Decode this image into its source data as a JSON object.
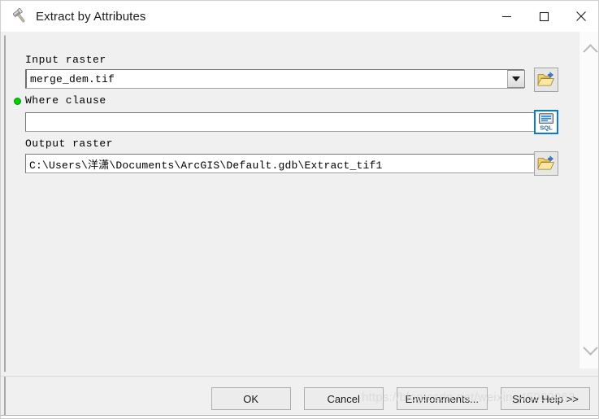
{
  "window": {
    "title": "Extract by Attributes",
    "icon": "hammer-tool-icon",
    "minimize_label": "—",
    "maximize_label": "□",
    "close_label": "✕"
  },
  "fields": {
    "input_raster": {
      "label": "Input raster",
      "value": "merge_dem.tif",
      "placeholder": "",
      "dropdown_icon": "chevron-down-icon",
      "browse_icon": "open-folder-icon",
      "required": false
    },
    "where_clause": {
      "label": "Where clause",
      "value": "",
      "placeholder": "",
      "sql_button_label": "SQL",
      "required": true,
      "required_marker_color": "#00cc00"
    },
    "output_raster": {
      "label": "Output raster",
      "value": "C:\\Users\\洋潇\\Documents\\ArcGIS\\Default.gdb\\Extract_tif1",
      "placeholder": "",
      "browse_icon": "open-folder-icon",
      "required": false
    }
  },
  "scrollbar": {
    "up_icon": "chevron-up-icon",
    "down_icon": "chevron-down-icon"
  },
  "footer": {
    "buttons": [
      {
        "name": "ok",
        "label": "OK"
      },
      {
        "name": "cancel",
        "label": "Cancel"
      },
      {
        "name": "environments",
        "label": "Environments..."
      },
      {
        "name": "show-help",
        "label": "Show Help >>"
      }
    ]
  },
  "watermark": {
    "text": "https://blog.csdn.net/weixin_45909963"
  }
}
